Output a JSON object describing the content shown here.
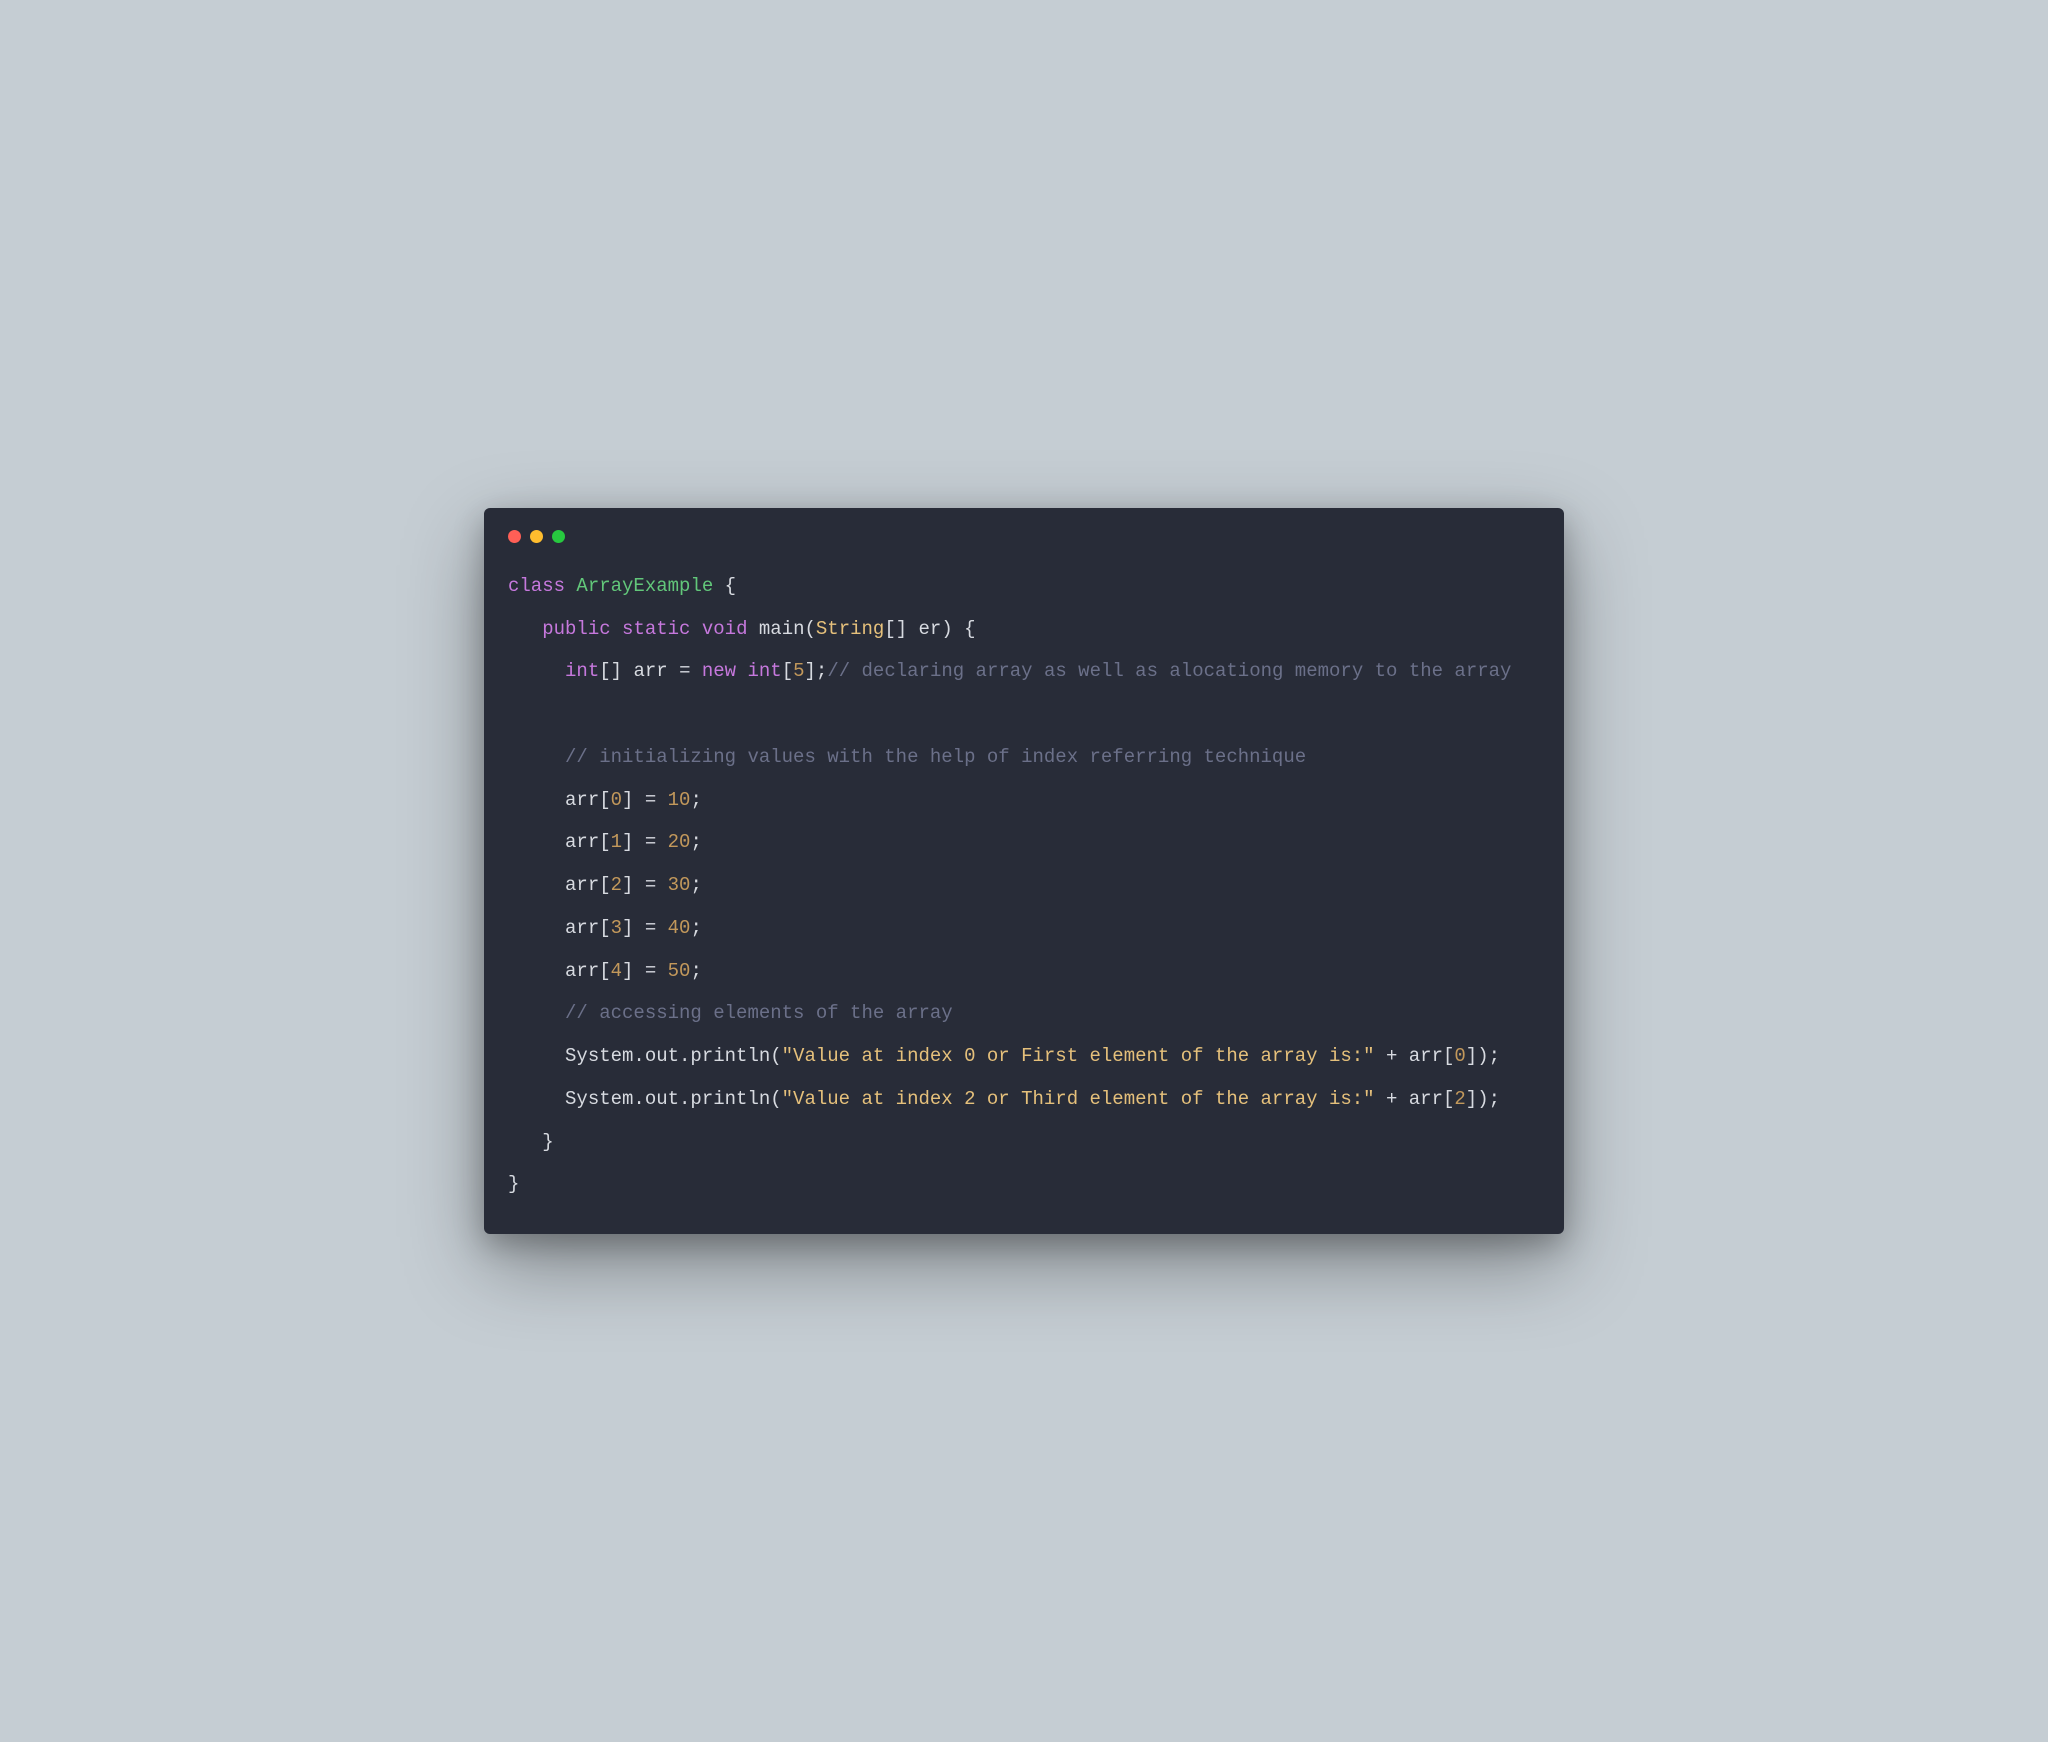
{
  "window": {
    "dots": {
      "red": "#ff5f56",
      "yellow": "#ffbd2e",
      "green": "#27c93f"
    }
  },
  "code": {
    "tokens": [
      {
        "t": "class ",
        "c": "kw"
      },
      {
        "t": "ArrayExample",
        "c": "cls"
      },
      {
        "t": " {",
        "c": "punct"
      },
      {
        "t": "\n"
      },
      {
        "t": "   ",
        "c": ""
      },
      {
        "t": "public ",
        "c": "kw"
      },
      {
        "t": "static ",
        "c": "kw"
      },
      {
        "t": "void ",
        "c": "kw"
      },
      {
        "t": "main",
        "c": "id"
      },
      {
        "t": "(",
        "c": "paren"
      },
      {
        "t": "String",
        "c": "typebuiltin"
      },
      {
        "t": "[] er) {",
        "c": "punct"
      },
      {
        "t": "\n"
      },
      {
        "t": "     ",
        "c": ""
      },
      {
        "t": "int",
        "c": "kw"
      },
      {
        "t": "[] arr ",
        "c": "id"
      },
      {
        "t": "= ",
        "c": "op"
      },
      {
        "t": "new ",
        "c": "kw"
      },
      {
        "t": "int",
        "c": "kw"
      },
      {
        "t": "[",
        "c": "punct"
      },
      {
        "t": "5",
        "c": "num"
      },
      {
        "t": "];",
        "c": "punct"
      },
      {
        "t": "// declaring array as well as alocationg memory to the array",
        "c": "cmt"
      },
      {
        "t": "\n"
      },
      {
        "t": "\n"
      },
      {
        "t": "     ",
        "c": ""
      },
      {
        "t": "// initializing values with the help of index referring technique",
        "c": "cmt"
      },
      {
        "t": "\n"
      },
      {
        "t": "     arr[",
        "c": "id"
      },
      {
        "t": "0",
        "c": "num"
      },
      {
        "t": "] ",
        "c": "punct"
      },
      {
        "t": "= ",
        "c": "op"
      },
      {
        "t": "10",
        "c": "num"
      },
      {
        "t": ";",
        "c": "punct"
      },
      {
        "t": "\n"
      },
      {
        "t": "     arr[",
        "c": "id"
      },
      {
        "t": "1",
        "c": "num"
      },
      {
        "t": "] ",
        "c": "punct"
      },
      {
        "t": "= ",
        "c": "op"
      },
      {
        "t": "20",
        "c": "num"
      },
      {
        "t": ";",
        "c": "punct"
      },
      {
        "t": "\n"
      },
      {
        "t": "     arr[",
        "c": "id"
      },
      {
        "t": "2",
        "c": "num"
      },
      {
        "t": "] ",
        "c": "punct"
      },
      {
        "t": "= ",
        "c": "op"
      },
      {
        "t": "30",
        "c": "num"
      },
      {
        "t": ";",
        "c": "punct"
      },
      {
        "t": "\n"
      },
      {
        "t": "     arr[",
        "c": "id"
      },
      {
        "t": "3",
        "c": "num"
      },
      {
        "t": "] ",
        "c": "punct"
      },
      {
        "t": "= ",
        "c": "op"
      },
      {
        "t": "40",
        "c": "num"
      },
      {
        "t": ";",
        "c": "punct"
      },
      {
        "t": "\n"
      },
      {
        "t": "     arr[",
        "c": "id"
      },
      {
        "t": "4",
        "c": "num"
      },
      {
        "t": "] ",
        "c": "punct"
      },
      {
        "t": "= ",
        "c": "op"
      },
      {
        "t": "50",
        "c": "num"
      },
      {
        "t": ";",
        "c": "punct"
      },
      {
        "t": "\n"
      },
      {
        "t": "     ",
        "c": ""
      },
      {
        "t": "// accessing elements of the array",
        "c": "cmt"
      },
      {
        "t": "\n"
      },
      {
        "t": "     System.out.println(",
        "c": "id"
      },
      {
        "t": "\"Value at index 0 or First element of the array is:\"",
        "c": "str"
      },
      {
        "t": " + arr[",
        "c": "id"
      },
      {
        "t": "0",
        "c": "num"
      },
      {
        "t": "]);",
        "c": "punct"
      },
      {
        "t": "\n"
      },
      {
        "t": "     System.out.println(",
        "c": "id"
      },
      {
        "t": "\"Value at index 2 or Third element of the array is:\"",
        "c": "str"
      },
      {
        "t": " + arr[",
        "c": "id"
      },
      {
        "t": "2",
        "c": "num"
      },
      {
        "t": "]);",
        "c": "punct"
      },
      {
        "t": "\n"
      },
      {
        "t": "   }",
        "c": "punct"
      },
      {
        "t": "\n"
      },
      {
        "t": "}",
        "c": "punct"
      }
    ]
  }
}
